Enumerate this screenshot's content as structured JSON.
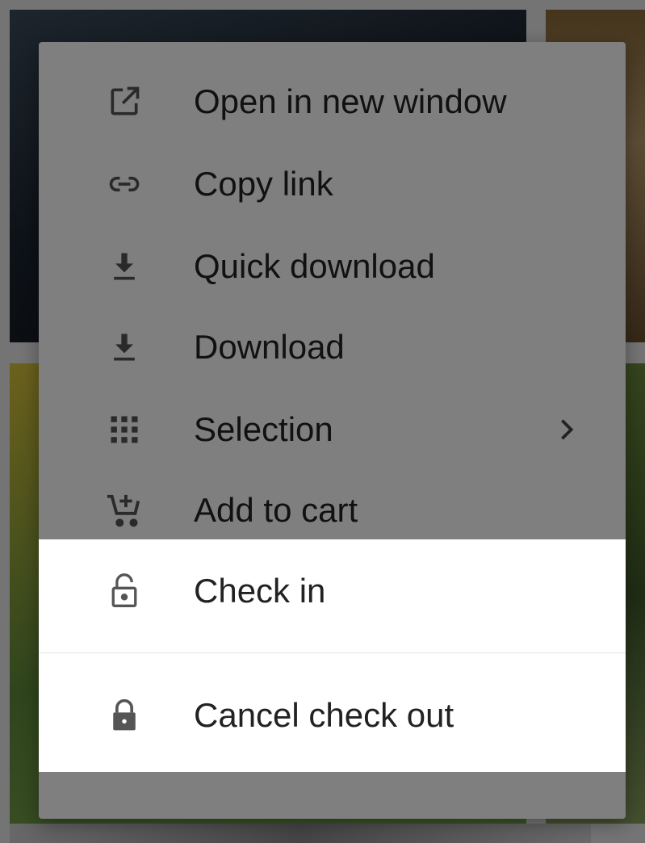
{
  "menu": {
    "items": [
      {
        "label": "Open in new window",
        "icon": "open-in-new-icon"
      },
      {
        "label": "Copy link",
        "icon": "link-icon"
      },
      {
        "label": "Quick download",
        "icon": "download-icon"
      },
      {
        "label": "Download",
        "icon": "download-icon"
      },
      {
        "label": "Selection",
        "icon": "grid-icon",
        "has_submenu": true
      },
      {
        "label": "Add to cart",
        "icon": "add-to-cart-icon"
      },
      {
        "label": "Check in",
        "icon": "unlock-icon"
      },
      {
        "label": "Cancel check out",
        "icon": "lock-icon"
      }
    ]
  },
  "colors": {
    "menu_background": "#ffffff",
    "text": "#222222",
    "icon": "#555555",
    "overlay": "rgba(0,0,0,0.5)"
  }
}
